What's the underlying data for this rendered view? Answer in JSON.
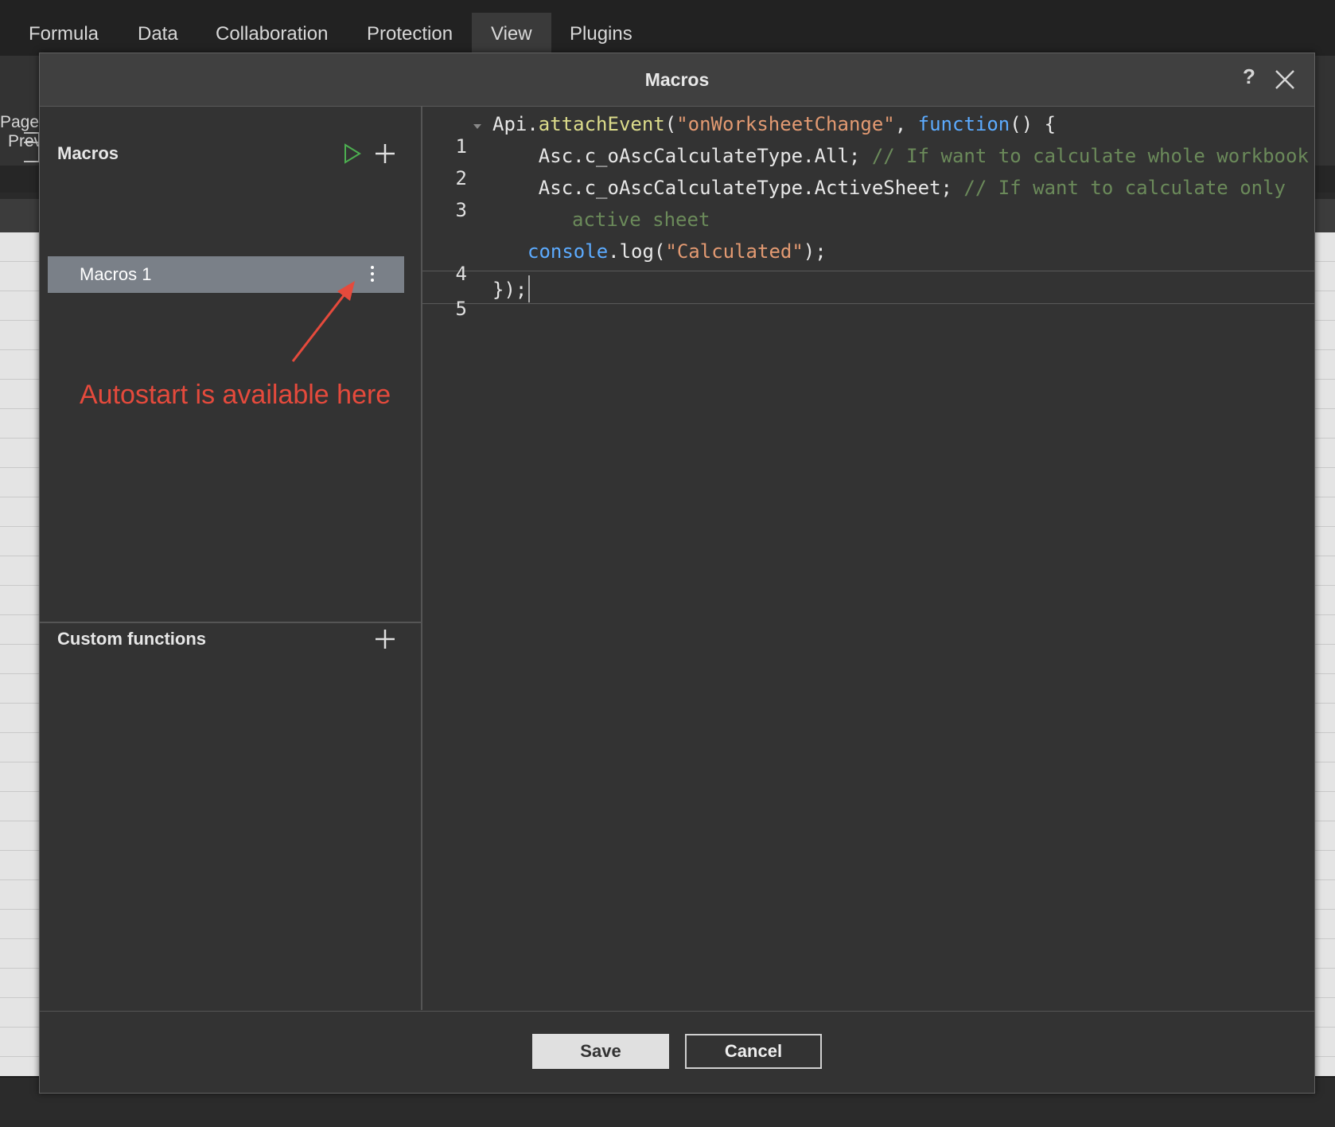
{
  "menubar": {
    "tabs": [
      {
        "label": "Formula"
      },
      {
        "label": "Data"
      },
      {
        "label": "Collaboration"
      },
      {
        "label": "Protection"
      },
      {
        "label": "View"
      },
      {
        "label": "Plugins"
      }
    ]
  },
  "toolbar": {
    "page_preview_line1": "Page",
    "page_preview_line2": "Prev"
  },
  "dialog": {
    "title": "Macros",
    "help_label": "?",
    "macros_section": {
      "title": "Macros",
      "items": [
        {
          "label": "Macros 1"
        }
      ]
    },
    "custom_functions_section": {
      "title": "Custom functions"
    },
    "annotation": "Autostart is available here",
    "editor": {
      "line_numbers": [
        "1",
        "2",
        "3",
        "4",
        "5"
      ],
      "tokens": {
        "l1_a": "Api.",
        "l1_b": "attachEvent",
        "l1_c": "(",
        "l1_d": "\"onWorksheetChange\"",
        "l1_e": ", ",
        "l1_f": "function",
        "l1_g": "() {",
        "l2_a": "    Asc.c_oAscCalculateType.All; ",
        "l2_b": "// If want to calculate whole workbook",
        "l3_a": "    Asc.c_oAscCalculateType.ActiveSheet; ",
        "l3_b": "// If want to calculate only",
        "l3_c": "active sheet",
        "l4_a": "console",
        "l4_b": ".log(",
        "l4_c": "\"Calculated\"",
        "l4_d": ");",
        "l5_a": "});"
      }
    },
    "buttons": {
      "save": "Save",
      "cancel": "Cancel"
    }
  },
  "colors": {
    "annotation": "#e54a3c",
    "keyword": "#5cabff",
    "string": "#e39a72",
    "comment": "#6b8a5a",
    "run_icon": "#4caf50"
  }
}
